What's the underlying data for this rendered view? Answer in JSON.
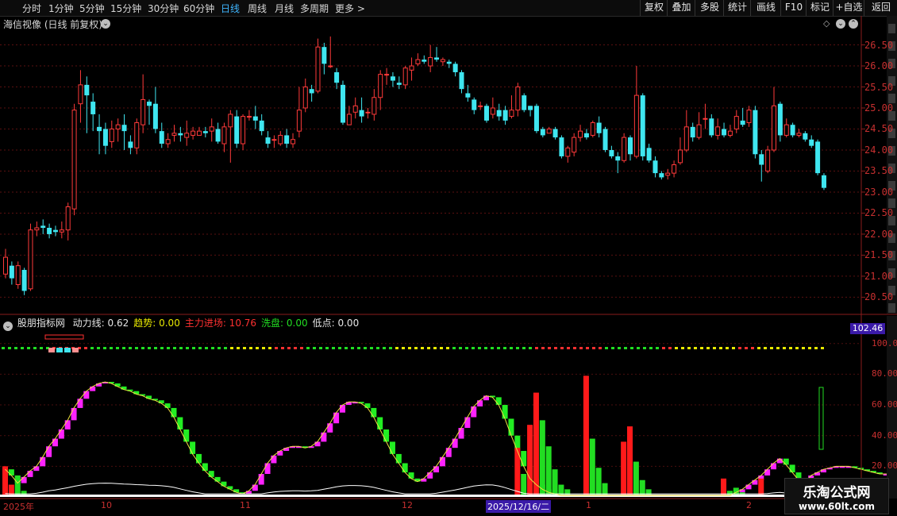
{
  "toolbar": {
    "periods": [
      "分时",
      "1分钟",
      "5分钟",
      "15分钟",
      "30分钟",
      "60分钟",
      "日线",
      "周线",
      "月线",
      "多周期",
      "更多 >"
    ],
    "active": "日线",
    "right_buttons": [
      "复权",
      "叠加",
      "多股",
      "统计",
      "画线",
      "F10",
      "标记",
      "+自选",
      "返回"
    ]
  },
  "chart_title": "海信视像 (日线 前复权)",
  "indicator": {
    "name": "股朋指标网",
    "fields": [
      {
        "label": "动力线:",
        "value": "0.62",
        "color": "#e6e6e6"
      },
      {
        "label": "趋势:",
        "value": "0.00",
        "color": "#e8e800"
      },
      {
        "label": "主力进场:",
        "value": "10.76",
        "color": "#ff3030"
      },
      {
        "label": "洗盘:",
        "value": "0.00",
        "color": "#22dd22"
      },
      {
        "label": "低点:",
        "value": "0.00",
        "color": "#e6e6e6"
      }
    ],
    "current_value": "102.46",
    "y_labels": [
      "100.0",
      "80.00",
      "60.00",
      "40.00",
      "20.00"
    ],
    "ylim": [
      0,
      102.46
    ]
  },
  "price_axis": {
    "labels": [
      "26.50",
      "26.00",
      "25.50",
      "25.00",
      "24.50",
      "24.00",
      "23.50",
      "23.00",
      "22.50",
      "22.00",
      "21.50",
      "21.00",
      "20.50"
    ],
    "ylim": [
      20.3,
      26.85
    ]
  },
  "x_axis": {
    "labels": [
      "2025年",
      "10",
      "11",
      "12",
      "2025/12/16/二",
      "1",
      "2"
    ]
  },
  "watermark": {
    "title": "乐淘公式网",
    "url": "www.60lt.com"
  },
  "chart_data": {
    "type": "candlestick",
    "ohlc": [
      [
        21.05,
        21.45,
        21.65,
        20.95
      ],
      [
        21.25,
        20.95,
        21.35,
        20.8
      ],
      [
        20.8,
        21.25,
        21.35,
        20.7
      ],
      [
        21.15,
        20.65,
        21.2,
        20.55
      ],
      [
        20.7,
        22.1,
        22.25,
        20.65
      ],
      [
        22.1,
        22.15,
        22.3,
        21.95
      ],
      [
        22.2,
        22.15,
        22.35,
        22.0
      ],
      [
        22.15,
        22.0,
        22.25,
        21.9
      ],
      [
        22.1,
        22.05,
        22.2,
        21.95
      ],
      [
        22.05,
        22.1,
        22.3,
        21.9
      ],
      [
        22.1,
        22.65,
        22.75,
        21.85
      ],
      [
        22.6,
        24.95,
        25.1,
        22.45
      ],
      [
        25.1,
        25.55,
        25.9,
        24.65
      ],
      [
        25.55,
        25.3,
        25.75,
        24.4
      ],
      [
        25.15,
        24.85,
        25.35,
        24.45
      ],
      [
        24.55,
        24.45,
        24.85,
        23.9
      ],
      [
        24.5,
        24.1,
        24.65,
        23.9
      ],
      [
        24.2,
        24.5,
        24.7,
        24.05
      ],
      [
        24.5,
        24.6,
        24.75,
        24.2
      ],
      [
        24.6,
        24.45,
        24.85,
        24.0
      ],
      [
        24.2,
        24.05,
        24.35,
        23.9
      ],
      [
        24.05,
        24.65,
        24.75,
        23.9
      ],
      [
        24.6,
        25.2,
        25.8,
        24.4
      ],
      [
        25.15,
        25.05,
        25.2,
        24.6
      ],
      [
        25.1,
        24.5,
        25.5,
        24.4
      ],
      [
        24.45,
        24.15,
        24.65,
        24.05
      ],
      [
        24.15,
        24.25,
        24.4,
        24.05
      ],
      [
        24.35,
        24.4,
        24.6,
        24.2
      ],
      [
        24.4,
        24.35,
        24.55,
        24.2
      ],
      [
        24.3,
        24.4,
        24.7,
        24.1
      ],
      [
        24.35,
        24.45,
        24.55,
        24.25
      ],
      [
        24.35,
        24.45,
        24.55,
        24.35
      ],
      [
        24.45,
        24.4,
        24.55,
        24.3
      ],
      [
        24.45,
        24.55,
        24.75,
        24.2
      ],
      [
        24.5,
        24.2,
        24.65,
        24.15
      ],
      [
        24.15,
        24.55,
        24.65,
        23.95
      ],
      [
        24.55,
        24.85,
        24.95,
        23.7
      ],
      [
        24.8,
        24.15,
        24.95,
        24.05
      ],
      [
        24.15,
        24.8,
        24.85,
        24.0
      ],
      [
        24.8,
        24.8,
        24.95,
        24.7
      ],
      [
        24.8,
        24.7,
        25.05,
        24.5
      ],
      [
        24.7,
        24.45,
        24.85,
        24.35
      ],
      [
        24.3,
        24.15,
        24.45,
        24.05
      ],
      [
        24.25,
        24.25,
        24.35,
        24.05
      ],
      [
        24.15,
        24.35,
        24.45,
        24.1
      ],
      [
        24.35,
        24.15,
        24.5,
        24.05
      ],
      [
        24.15,
        24.25,
        24.4,
        24.05
      ],
      [
        24.45,
        24.95,
        25.5,
        24.3
      ],
      [
        25.0,
        25.5,
        25.7,
        24.9
      ],
      [
        25.45,
        25.35,
        25.55,
        25.15
      ],
      [
        25.4,
        26.45,
        26.65,
        25.35
      ],
      [
        26.45,
        26.05,
        26.55,
        25.8
      ],
      [
        26.0,
        26.0,
        26.7,
        25.95
      ],
      [
        25.85,
        25.6,
        25.95,
        25.45
      ],
      [
        25.55,
        24.65,
        25.65,
        24.6
      ],
      [
        24.6,
        24.85,
        25.05,
        24.65
      ],
      [
        24.9,
        25.05,
        25.25,
        24.75
      ],
      [
        24.95,
        24.8,
        25.25,
        24.65
      ],
      [
        24.9,
        24.9,
        25.0,
        24.75
      ],
      [
        24.85,
        25.25,
        25.45,
        24.7
      ],
      [
        25.25,
        25.8,
        25.9,
        24.95
      ],
      [
        25.8,
        25.8,
        25.95,
        25.55
      ],
      [
        25.75,
        25.65,
        25.85,
        25.5
      ],
      [
        25.6,
        25.55,
        25.75,
        25.45
      ],
      [
        25.55,
        25.95,
        26.0,
        25.45
      ],
      [
        25.9,
        26.0,
        26.2,
        25.65
      ],
      [
        26.05,
        26.15,
        26.3,
        26.0
      ],
      [
        26.15,
        26.1,
        26.25,
        26.05
      ],
      [
        26.0,
        26.2,
        26.5,
        25.85
      ],
      [
        26.2,
        26.15,
        26.45,
        26.1
      ],
      [
        26.1,
        26.15,
        26.2,
        26.0
      ],
      [
        26.1,
        26.05,
        26.15,
        25.95
      ],
      [
        26.05,
        25.85,
        26.1,
        25.75
      ],
      [
        25.85,
        25.45,
        25.9,
        25.35
      ],
      [
        25.35,
        25.25,
        25.55,
        25.15
      ],
      [
        25.2,
        24.95,
        25.25,
        24.85
      ],
      [
        25.05,
        25.05,
        25.15,
        24.95
      ],
      [
        25.05,
        24.7,
        25.1,
        24.65
      ],
      [
        24.85,
        25.0,
        25.25,
        24.75
      ],
      [
        24.95,
        24.8,
        25.1,
        24.7
      ],
      [
        24.95,
        24.7,
        25.05,
        24.6
      ],
      [
        24.8,
        24.95,
        25.3,
        24.75
      ],
      [
        24.95,
        25.5,
        25.6,
        24.8
      ],
      [
        25.3,
        24.95,
        25.35,
        24.9
      ],
      [
        25.05,
        24.95,
        25.05,
        24.8
      ],
      [
        25.05,
        24.45,
        25.1,
        24.4
      ],
      [
        24.5,
        24.35,
        24.55,
        24.3
      ],
      [
        24.4,
        24.5,
        24.55,
        24.4
      ],
      [
        24.5,
        24.3,
        24.55,
        24.25
      ],
      [
        24.3,
        23.85,
        24.35,
        23.8
      ],
      [
        23.85,
        24.05,
        24.1,
        23.7
      ],
      [
        23.95,
        24.3,
        24.4,
        23.85
      ],
      [
        24.3,
        24.45,
        24.6,
        24.2
      ],
      [
        24.4,
        24.3,
        24.5,
        24.25
      ],
      [
        24.35,
        24.65,
        24.7,
        24.3
      ],
      [
        24.65,
        24.4,
        24.8,
        24.3
      ],
      [
        24.5,
        24.0,
        24.55,
        23.95
      ],
      [
        24.0,
        23.85,
        24.1,
        23.8
      ],
      [
        23.85,
        23.75,
        23.95,
        23.45
      ],
      [
        23.75,
        24.3,
        24.4,
        23.7
      ],
      [
        24.3,
        23.9,
        24.35,
        23.75
      ],
      [
        23.85,
        25.3,
        26.0,
        23.8
      ],
      [
        25.3,
        23.85,
        25.35,
        23.75
      ],
      [
        24.05,
        23.75,
        24.15,
        23.7
      ],
      [
        23.75,
        23.45,
        23.85,
        23.35
      ],
      [
        23.45,
        23.35,
        23.5,
        23.3
      ],
      [
        23.4,
        23.45,
        23.55,
        23.3
      ],
      [
        23.45,
        23.65,
        23.75,
        23.35
      ],
      [
        23.7,
        24.0,
        24.3,
        23.65
      ],
      [
        24.0,
        24.55,
        24.95,
        23.95
      ],
      [
        24.55,
        24.3,
        24.65,
        24.2
      ],
      [
        24.3,
        24.6,
        24.9,
        24.25
      ],
      [
        24.75,
        24.75,
        25.1,
        24.5
      ],
      [
        24.75,
        24.35,
        24.85,
        24.3
      ],
      [
        24.35,
        24.55,
        24.75,
        24.25
      ],
      [
        24.5,
        24.35,
        24.65,
        24.3
      ],
      [
        24.35,
        24.45,
        24.6,
        24.3
      ],
      [
        24.5,
        24.8,
        24.95,
        24.4
      ],
      [
        24.7,
        24.6,
        25.0,
        24.55
      ],
      [
        24.65,
        24.95,
        25.05,
        24.55
      ],
      [
        24.95,
        23.9,
        25.05,
        23.8
      ],
      [
        23.9,
        23.65,
        24.0,
        23.25
      ],
      [
        23.5,
        24.0,
        24.1,
        23.45
      ],
      [
        24.0,
        25.05,
        25.5,
        23.95
      ],
      [
        25.1,
        24.35,
        25.15,
        24.2
      ],
      [
        24.35,
        24.6,
        24.75,
        24.3
      ],
      [
        24.6,
        24.35,
        24.65,
        24.3
      ],
      [
        24.35,
        24.4,
        24.5,
        24.3
      ],
      [
        24.4,
        24.25,
        24.45,
        24.2
      ],
      [
        24.25,
        24.1,
        24.35,
        24.05
      ],
      [
        24.2,
        23.45,
        24.25,
        23.4
      ],
      [
        23.4,
        23.1,
        23.45,
        23.05
      ]
    ],
    "dynamic_line": [
      18,
      14,
      9,
      13,
      17,
      20,
      26,
      33,
      38,
      44,
      50,
      58,
      64,
      69,
      72,
      74,
      75,
      74,
      72,
      70,
      69,
      67,
      66,
      64,
      63,
      61,
      58,
      52,
      44,
      36,
      28,
      22,
      17,
      13,
      10,
      7,
      5,
      3,
      2,
      4,
      8,
      15,
      22,
      27,
      30,
      32,
      33,
      33,
      32,
      33,
      36,
      42,
      48,
      55,
      60,
      62,
      62,
      61,
      58,
      52,
      44,
      36,
      28,
      22,
      16,
      12,
      10,
      12,
      16,
      20,
      26,
      32,
      38,
      45,
      52,
      59,
      63,
      66,
      65,
      60,
      51,
      40,
      30,
      20,
      12,
      8,
      5,
      3,
      2,
      1,
      1,
      1,
      1,
      1,
      1,
      1,
      1,
      1,
      1,
      1,
      1,
      1,
      1,
      1,
      1,
      1,
      1,
      1,
      1,
      1,
      1,
      1,
      1,
      1,
      1,
      1,
      1,
      3,
      5,
      8,
      11,
      14,
      18,
      22,
      25,
      21,
      16,
      11,
      9,
      14,
      16,
      18,
      19,
      20,
      20,
      20,
      19,
      18,
      17,
      16,
      15,
      15,
      15
    ],
    "main_force": [
      {
        "i": 0,
        "v": 20
      },
      {
        "i": 1,
        "v": 8
      },
      {
        "i": 82,
        "v": 32
      },
      {
        "i": 84,
        "v": 47
      },
      {
        "i": 85,
        "v": 68
      },
      {
        "i": 93,
        "v": 79
      },
      {
        "i": 99,
        "v": 36
      },
      {
        "i": 100,
        "v": 46
      },
      {
        "i": 115,
        "v": 12
      },
      {
        "i": 121,
        "v": 12
      }
    ],
    "washout": [
      {
        "i": 2,
        "v": 14
      },
      {
        "i": 3,
        "v": 4
      },
      {
        "i": 83,
        "v": 15
      },
      {
        "i": 86,
        "v": 50
      },
      {
        "i": 87,
        "v": 33
      },
      {
        "i": 88,
        "v": 18
      },
      {
        "i": 89,
        "v": 8
      },
      {
        "i": 90,
        "v": 5
      },
      {
        "i": 94,
        "v": 38
      },
      {
        "i": 95,
        "v": 19
      },
      {
        "i": 96,
        "v": 9
      },
      {
        "i": 101,
        "v": 23
      },
      {
        "i": 102,
        "v": 11
      },
      {
        "i": 103,
        "v": 5
      },
      {
        "i": 116,
        "v": 4
      },
      {
        "i": 117,
        "v": 6
      },
      {
        "i": 118,
        "v": 3
      }
    ]
  }
}
